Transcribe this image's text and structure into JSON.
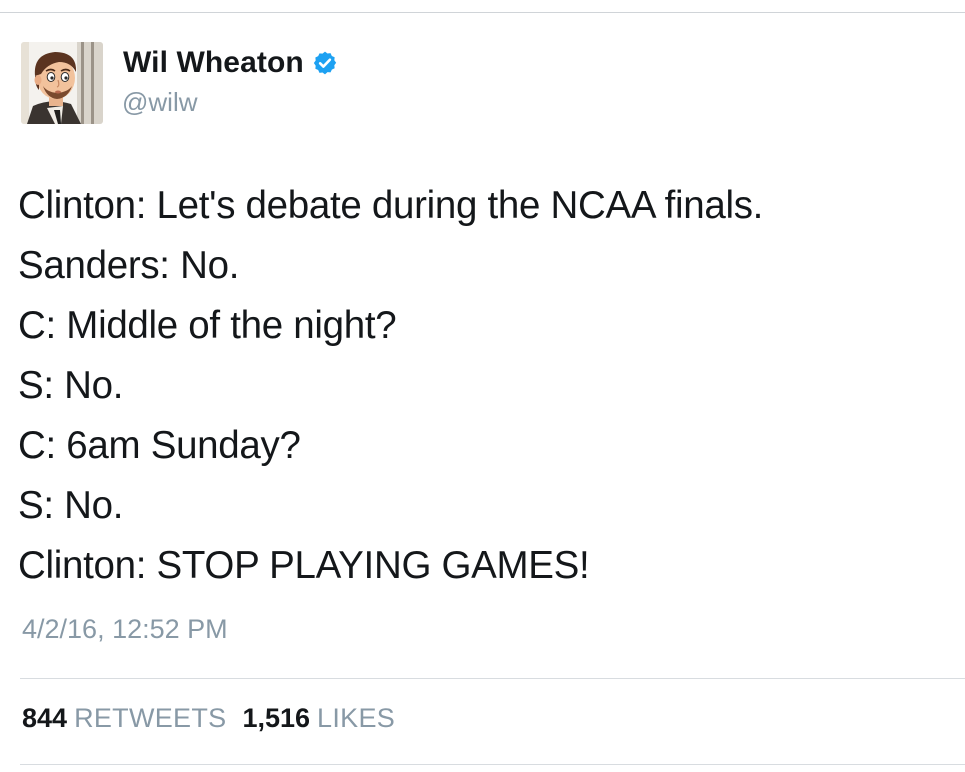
{
  "author": {
    "display_name": "Wil Wheaton",
    "handle": "@wilw",
    "verified": true,
    "avatar_icon": "cartoon-portrait-avatar"
  },
  "tweet": {
    "lines": [
      "Clinton: Let's debate during the NCAA finals.",
      "Sanders: No.",
      "C: Middle of the night?",
      "S: No.",
      "C: 6am Sunday?",
      "S: No.",
      "Clinton: STOP PLAYING GAMES!"
    ],
    "timestamp": "4/2/16, 12:52 PM"
  },
  "stats": {
    "retweets_count": "844",
    "retweets_label": "RETWEETS",
    "likes_count": "1,516",
    "likes_label": "LIKES"
  },
  "colors": {
    "text": "#14171a",
    "muted": "#8899a6",
    "verified_badge": "#1da1f2",
    "divider": "#d8dce0"
  }
}
